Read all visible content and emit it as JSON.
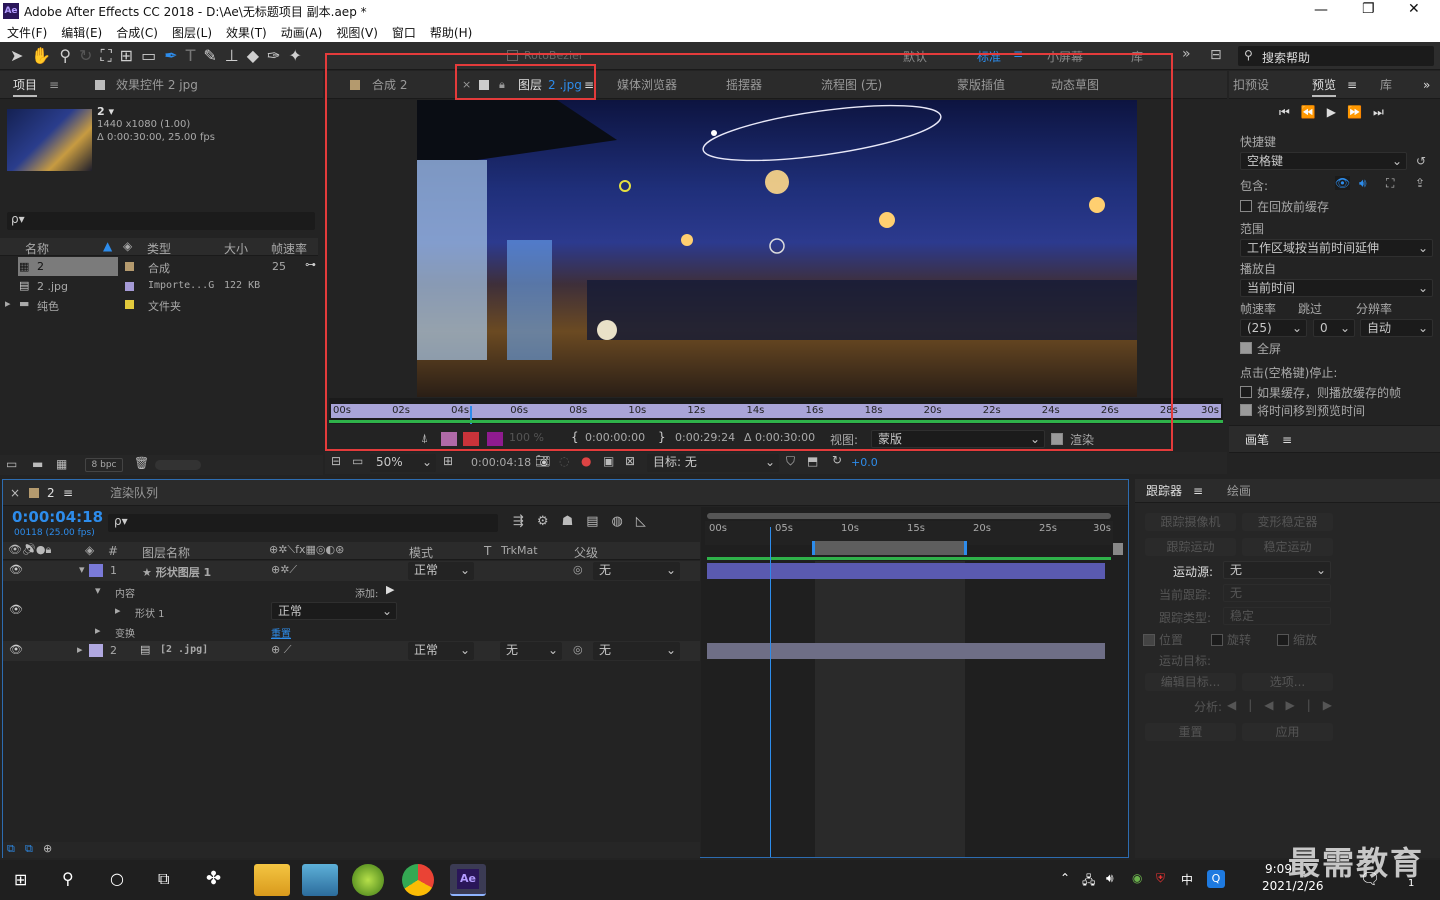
{
  "window": {
    "title": "Adobe After Effects CC 2018 - D:\\Ae\\无标题项目 副本.aep *",
    "app_icon": "Ae",
    "controls": [
      "—",
      "❐",
      "✕"
    ]
  },
  "menu": [
    "文件(F)",
    "编辑(E)",
    "合成(C)",
    "图层(L)",
    "效果(T)",
    "动画(A)",
    "视图(V)",
    "窗口",
    "帮助(H)"
  ],
  "toolbar": {
    "rotobezier": "RotoBezier",
    "workspaces": [
      "默认",
      "标准",
      "小屏幕",
      "库"
    ],
    "active_workspace": "标准",
    "search_placeholder": "搜索帮助"
  },
  "project_panel": {
    "tab_project": "项目",
    "tab_effects": "效果控件 2 jpg",
    "item_name": "2 ▾",
    "item_info_1": "1440 x1080 (1.00)",
    "item_info_2": "Δ 0:00:30:00, 25.00 fps",
    "search_placeholder": "ρ▾",
    "columns": [
      "名称",
      "类型",
      "大小",
      "帧速率"
    ],
    "rows": [
      {
        "name": "2",
        "type": "合成",
        "size": "",
        "fps": "25",
        "color": "#b49a6e"
      },
      {
        "name": "2 .jpg",
        "type": "Importe...G",
        "size": "122 KB",
        "fps": "",
        "color": "#a59ad6"
      },
      {
        "name": "纯色",
        "type": "文件夹",
        "size": "",
        "fps": "",
        "color": "#e2c93c"
      }
    ],
    "bpc": "8 bpc"
  },
  "viewer": {
    "tabs": [
      "合成 2",
      "图层",
      "2 .jpg",
      "媒体浏览器",
      "摇摆器",
      "流程图 (无)",
      "蒙版插值",
      "动态草图"
    ],
    "ruler_labels": [
      "00s",
      "02s",
      "04s",
      "06s",
      "08s",
      "10s",
      "12s",
      "14s",
      "16s",
      "18s",
      "20s",
      "22s",
      "24s",
      "26s",
      "28s",
      "30s"
    ],
    "current_marker": 0.155,
    "zoom": "100 %",
    "time_in": "0:00:00:00",
    "time_out": "0:00:29:24",
    "duration": "Δ 0:00:30:00",
    "view_label": "视图:",
    "view_value": "蒙版",
    "render_label": "渲染",
    "bottom_zoom": "50%",
    "bottom_time": "0:00:04:18",
    "target_label": "目标: 无",
    "exposure": "+0.0"
  },
  "preview_panel": {
    "tabs": [
      "扣预设",
      "预览",
      "库"
    ],
    "shortcut_label": "快捷键",
    "shortcut_value": "空格键",
    "include_label": "包含:",
    "cache_before": "在回放前缓存",
    "range_label": "范围",
    "range_value": "工作区域按当前时间延伸",
    "play_from_label": "播放自",
    "play_from_value": "当前时间",
    "fps_label": "帧速率",
    "skip_label": "跳过",
    "resolution_label": "分辨率",
    "fps_value": "(25)",
    "skip_value": "0",
    "resolution_value": "自动",
    "fullscreen": "全屏",
    "stop_label": "点击(空格键)停止:",
    "stop_opt_1": "如果缓存，则播放缓存的帧",
    "stop_opt_2": "将时间移到预览时间",
    "brush_tab": "画笔"
  },
  "timeline": {
    "tab_comp": "2",
    "tab_render": "渲染队列",
    "timecode": "0:00:04:18",
    "frames": "00118 (25.00 fps)",
    "search_placeholder": "ρ▾",
    "columns": {
      "num": "#",
      "name": "图层名称",
      "mode": "模式",
      "t": "T",
      "trkmat": "TrkMat",
      "parent": "父级"
    },
    "ruler_labels": [
      "00s",
      "05s",
      "10s",
      "15s",
      "20s",
      "25s",
      "30s"
    ],
    "layers": [
      {
        "num": "1",
        "name": "★ 形状图层 1",
        "mode": "正常",
        "trkmat": "",
        "parent": "无",
        "color": "#7a7ad8"
      },
      {
        "num": "2",
        "name": "[2 .jpg]",
        "mode": "正常",
        "trkmat": "无",
        "parent": "无",
        "color": "#b0a8e0"
      }
    ],
    "sub_content": "内容",
    "sub_add": "添加:",
    "sub_shape": "形状 1",
    "sub_shape_mode": "正常",
    "sub_transform": "变换",
    "sub_reset": "重置",
    "playhead_fraction": 0.155
  },
  "tracker_panel": {
    "tab_tracker": "跟踪器",
    "tab_paint": "绘画",
    "btn_track_camera": "跟踪摄像机",
    "btn_warp": "变形稳定器",
    "btn_track_motion": "跟踪运动",
    "btn_stabilize": "稳定运动",
    "motion_source_label": "运动源:",
    "motion_source_value": "无",
    "current_track_label": "当前跟踪:",
    "current_track_value": "无",
    "track_type_label": "跟踪类型:",
    "track_type_value": "稳定",
    "opt_position": "位置",
    "opt_rotation": "旋转",
    "opt_scale": "缩放",
    "motion_target_label": "运动目标:",
    "btn_edit_target": "编辑目标...",
    "btn_options": "选项...",
    "analyze_label": "分析:",
    "btn_reset": "重置",
    "btn_apply": "应用"
  },
  "taskbar": {
    "time": "9:09",
    "date": "2021/2/26",
    "ime": "中",
    "notif": "1"
  },
  "watermark": "最需教育"
}
